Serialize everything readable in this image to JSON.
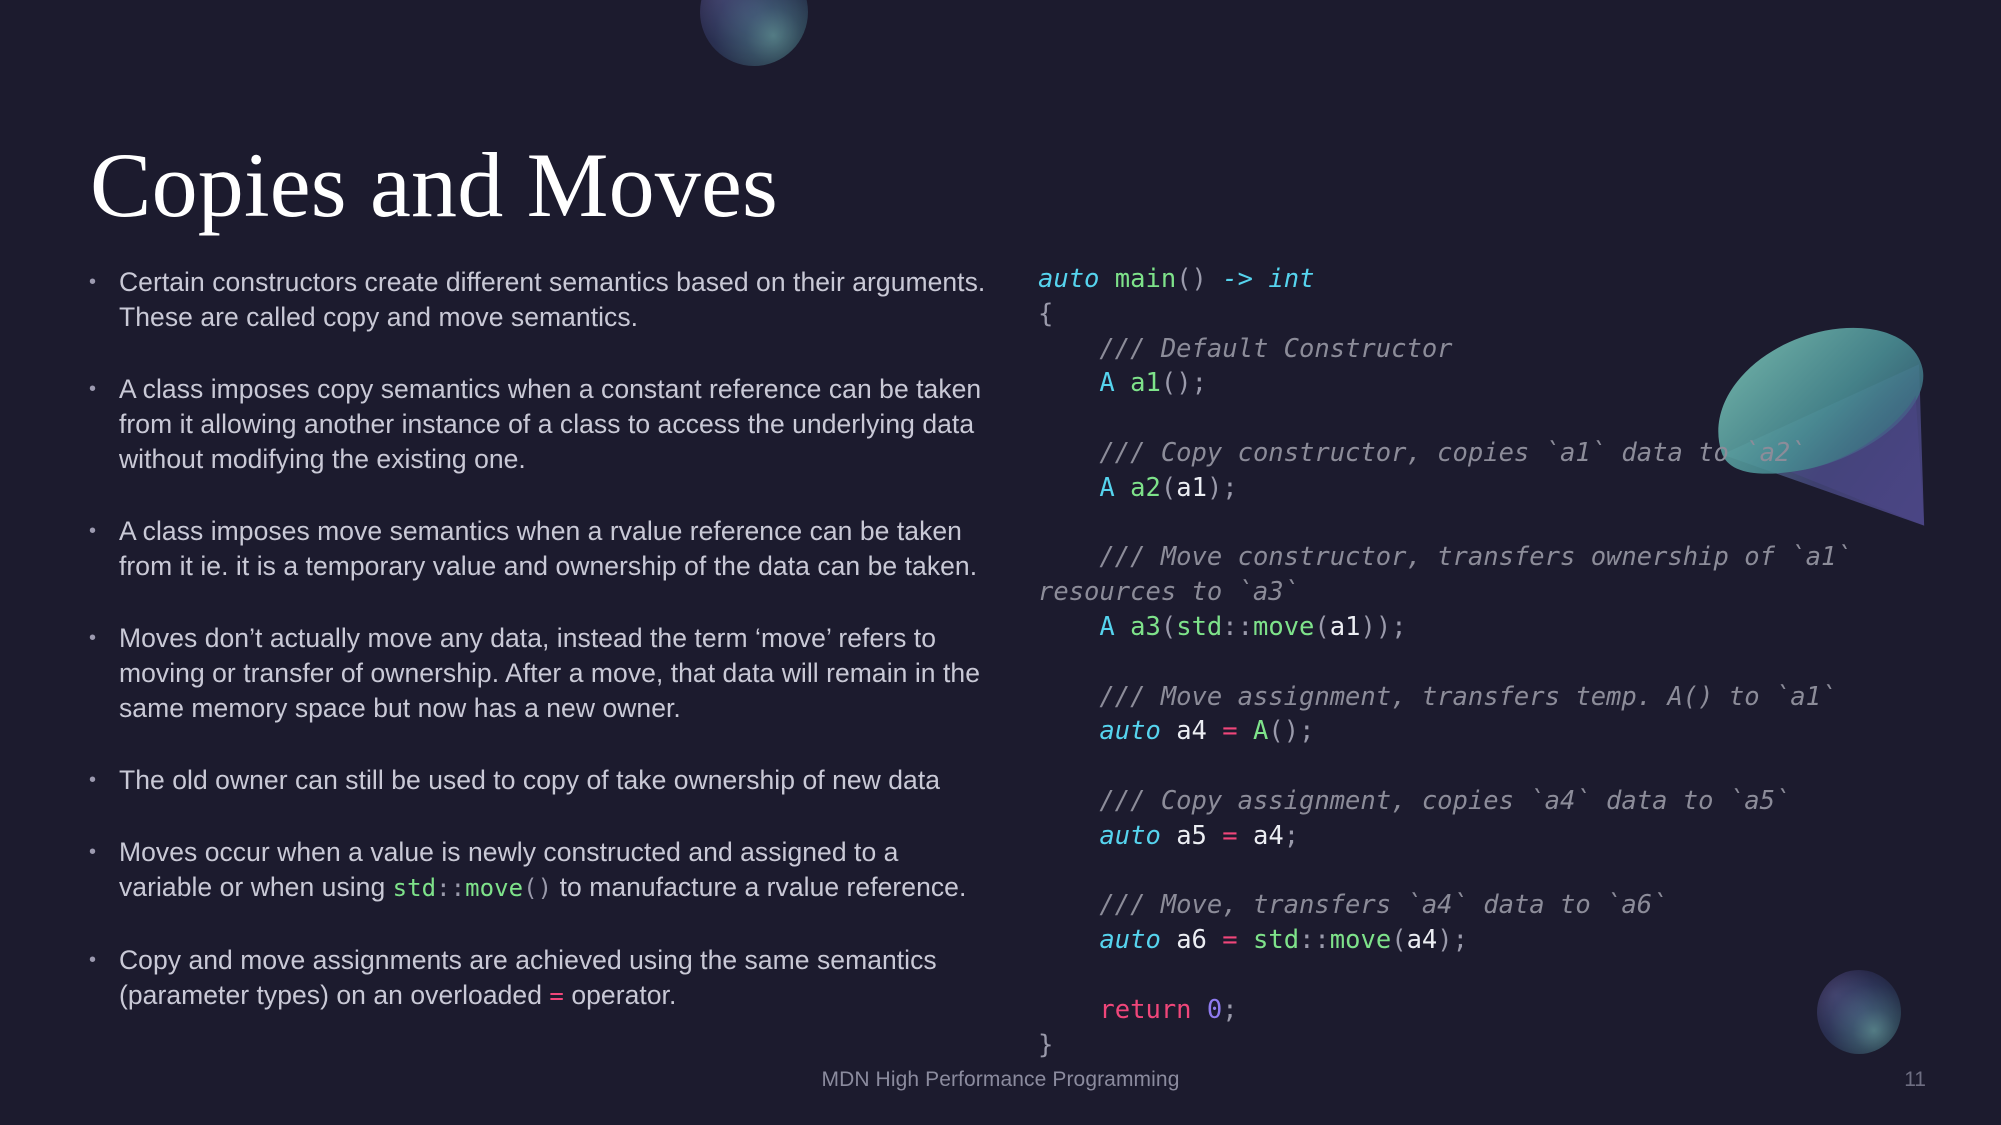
{
  "slide": {
    "title": "Copies and Moves",
    "footer_title": "MDN High Performance Programming",
    "page_number": "11",
    "background_color": "#1c1b2e",
    "title_color": "#ffffff",
    "body_text_color": "#c9c9d6"
  },
  "bullet_marker": "•",
  "bullets": [
    {
      "id": "bullet-semantics-intro",
      "parts": [
        {
          "type": "text",
          "value": "Certain constructors create different semantics based on their arguments. These are called copy and move semantics."
        }
      ]
    },
    {
      "id": "bullet-copy-semantics",
      "parts": [
        {
          "type": "text",
          "value": "A class imposes copy semantics when a constant reference can be taken from it allowing another instance of a class to access the underlying data without modifying the existing one."
        }
      ]
    },
    {
      "id": "bullet-move-semantics",
      "parts": [
        {
          "type": "text",
          "value": "A class imposes move semantics when a rvalue reference can be taken from it ie. it is a temporary value and ownership of the data can be taken."
        }
      ]
    },
    {
      "id": "bullet-moves-dont-move",
      "parts": [
        {
          "type": "text",
          "value": "Moves don’t actually move any data, instead the term ‘move’ refers to moving or transfer of ownership. After a move, that data will remain in the same memory space but now has a new owner."
        }
      ]
    },
    {
      "id": "bullet-old-owner",
      "parts": [
        {
          "type": "text",
          "value": "The old owner can still be used to copy of take ownership of new data"
        }
      ]
    },
    {
      "id": "bullet-moves-occur",
      "parts": [
        {
          "type": "text",
          "value": "Moves occur when a value is newly constructed and assigned to a variable or when using "
        },
        {
          "type": "code-fn",
          "value": "std"
        },
        {
          "type": "code-punc",
          "value": "::"
        },
        {
          "type": "code-fn",
          "value": "move"
        },
        {
          "type": "code-punc",
          "value": "()"
        },
        {
          "type": "text",
          "value": " to manufacture a rvalue reference."
        }
      ]
    },
    {
      "id": "bullet-assignments",
      "parts": [
        {
          "type": "text",
          "value": "Copy and move assignments are achieved using the same semantics (parameter types) on an overloaded "
        },
        {
          "type": "code-op",
          "value": "="
        },
        {
          "type": "text",
          "value": " operator."
        }
      ]
    }
  ],
  "code": {
    "language": "cpp",
    "lines": [
      [
        {
          "t": "kw-it",
          "v": "auto"
        },
        {
          "t": "plain",
          "v": " "
        },
        {
          "t": "fn",
          "v": "main"
        },
        {
          "t": "punc",
          "v": "()"
        },
        {
          "t": "plain",
          "v": " "
        },
        {
          "t": "kw-it",
          "v": "->"
        },
        {
          "t": "plain",
          "v": " "
        },
        {
          "t": "kw-it",
          "v": "int"
        }
      ],
      [
        {
          "t": "punc",
          "v": "{"
        }
      ],
      [
        {
          "t": "comment",
          "v": "    /// Default Constructor"
        }
      ],
      [
        {
          "t": "plain",
          "v": "    "
        },
        {
          "t": "type",
          "v": "A"
        },
        {
          "t": "plain",
          "v": " "
        },
        {
          "t": "fn",
          "v": "a1"
        },
        {
          "t": "punc",
          "v": "();"
        }
      ],
      [
        {
          "t": "plain",
          "v": " "
        }
      ],
      [
        {
          "t": "comment",
          "v": "    /// Copy constructor, copies `a1` data to `a2`"
        }
      ],
      [
        {
          "t": "plain",
          "v": "    "
        },
        {
          "t": "type",
          "v": "A"
        },
        {
          "t": "plain",
          "v": " "
        },
        {
          "t": "fn",
          "v": "a2"
        },
        {
          "t": "punc",
          "v": "("
        },
        {
          "t": "var",
          "v": "a1"
        },
        {
          "t": "punc",
          "v": ");"
        }
      ],
      [
        {
          "t": "plain",
          "v": " "
        }
      ],
      [
        {
          "t": "comment",
          "v": "    /// Move constructor, transfers ownership of `a1` resources to `a3`"
        }
      ],
      [
        {
          "t": "plain",
          "v": "    "
        },
        {
          "t": "type",
          "v": "A"
        },
        {
          "t": "plain",
          "v": " "
        },
        {
          "t": "fn",
          "v": "a3"
        },
        {
          "t": "punc",
          "v": "("
        },
        {
          "t": "fn",
          "v": "std"
        },
        {
          "t": "punc",
          "v": "::"
        },
        {
          "t": "fn",
          "v": "move"
        },
        {
          "t": "punc",
          "v": "("
        },
        {
          "t": "var",
          "v": "a1"
        },
        {
          "t": "punc",
          "v": "));"
        }
      ],
      [
        {
          "t": "plain",
          "v": " "
        }
      ],
      [
        {
          "t": "comment",
          "v": "    /// Move assignment, transfers temp. A() to `a1`"
        }
      ],
      [
        {
          "t": "plain",
          "v": "    "
        },
        {
          "t": "kw-it",
          "v": "auto"
        },
        {
          "t": "plain",
          "v": " "
        },
        {
          "t": "var",
          "v": "a4"
        },
        {
          "t": "plain",
          "v": " "
        },
        {
          "t": "op",
          "v": "="
        },
        {
          "t": "plain",
          "v": " "
        },
        {
          "t": "fn",
          "v": "A"
        },
        {
          "t": "punc",
          "v": "();"
        }
      ],
      [
        {
          "t": "plain",
          "v": " "
        }
      ],
      [
        {
          "t": "comment",
          "v": "    /// Copy assignment, copies `a4` data to `a5`"
        }
      ],
      [
        {
          "t": "plain",
          "v": "    "
        },
        {
          "t": "kw-it",
          "v": "auto"
        },
        {
          "t": "plain",
          "v": " "
        },
        {
          "t": "var",
          "v": "a5"
        },
        {
          "t": "plain",
          "v": " "
        },
        {
          "t": "op",
          "v": "="
        },
        {
          "t": "plain",
          "v": " "
        },
        {
          "t": "var",
          "v": "a4"
        },
        {
          "t": "punc",
          "v": ";"
        }
      ],
      [
        {
          "t": "plain",
          "v": " "
        }
      ],
      [
        {
          "t": "comment",
          "v": "    /// Move, transfers `a4` data to `a6`"
        }
      ],
      [
        {
          "t": "plain",
          "v": "    "
        },
        {
          "t": "kw-it",
          "v": "auto"
        },
        {
          "t": "plain",
          "v": " "
        },
        {
          "t": "var",
          "v": "a6"
        },
        {
          "t": "plain",
          "v": " "
        },
        {
          "t": "op",
          "v": "="
        },
        {
          "t": "plain",
          "v": " "
        },
        {
          "t": "fn",
          "v": "std"
        },
        {
          "t": "punc",
          "v": "::"
        },
        {
          "t": "fn",
          "v": "move"
        },
        {
          "t": "punc",
          "v": "("
        },
        {
          "t": "var",
          "v": "a4"
        },
        {
          "t": "punc",
          "v": ");"
        }
      ],
      [
        {
          "t": "plain",
          "v": " "
        }
      ],
      [
        {
          "t": "plain",
          "v": "    "
        },
        {
          "t": "op",
          "v": "return"
        },
        {
          "t": "plain",
          "v": " "
        },
        {
          "t": "num",
          "v": "0"
        },
        {
          "t": "punc",
          "v": ";"
        }
      ],
      [
        {
          "t": "punc",
          "v": "}"
        }
      ]
    ],
    "colors": {
      "comment": "#8c8c99",
      "keyword": "#56d4ee",
      "function": "#7ee28a",
      "punctuation": "#9a9aab",
      "variable": "#eceef3",
      "operator": "#f0467a",
      "number": "#8f7bf0"
    }
  },
  "decorations": [
    {
      "name": "sphere-top",
      "shape": "sphere"
    },
    {
      "name": "cone",
      "shape": "cone"
    },
    {
      "name": "sphere-bottom",
      "shape": "sphere"
    }
  ]
}
